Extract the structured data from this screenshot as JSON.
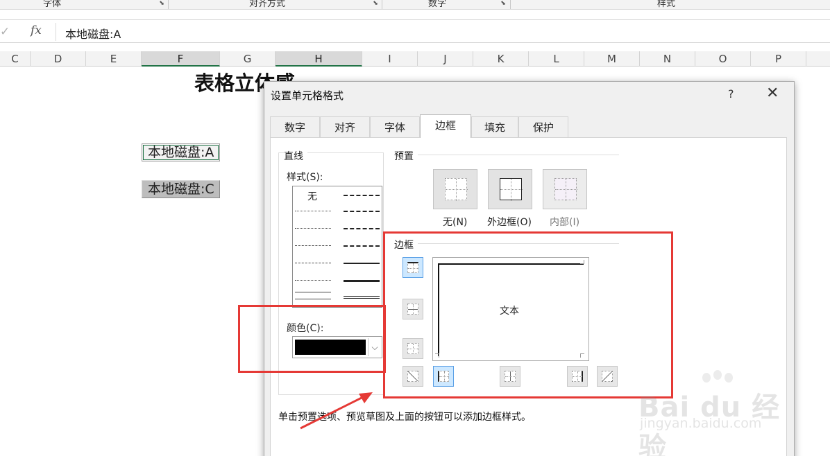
{
  "ribbon": {
    "groups": [
      "字体",
      "对齐方式",
      "数字",
      "样式"
    ]
  },
  "formula_bar": {
    "cancel_glyph": "✓",
    "fx_label": "fx",
    "value": "本地磁盘:A"
  },
  "columns": [
    "C",
    "D",
    "E",
    "F",
    "G",
    "H",
    "I",
    "J",
    "K",
    "L",
    "M",
    "N",
    "O",
    "P"
  ],
  "selected_columns": [
    "F",
    "H"
  ],
  "sheet": {
    "title": "表格立体感",
    "cell_a": "本地磁盘:A",
    "cell_c": "本地磁盘:C"
  },
  "dialog": {
    "title": "设置单元格格式",
    "help": "?",
    "close": "✕",
    "tabs": [
      "数字",
      "对齐",
      "字体",
      "边框",
      "填充",
      "保护"
    ],
    "active_tab": "边框",
    "line_group": "直线",
    "style_label": "样式(S):",
    "style_none": "无",
    "color_label": "颜色(C):",
    "color_value": "#000000",
    "preset_group": "预置",
    "presets": [
      "无(N)",
      "外边框(O)",
      "内部(I)"
    ],
    "border_group": "边框",
    "preview_text": "文本",
    "hint": "单击预置选项、预览草图及上面的按钮可以添加边框样式。"
  },
  "colors": {
    "annotation": "#e53935",
    "excel_green": "#217346"
  },
  "watermark": {
    "brand": "Bai du 经验",
    "url": "jingyan.baidu.com"
  }
}
